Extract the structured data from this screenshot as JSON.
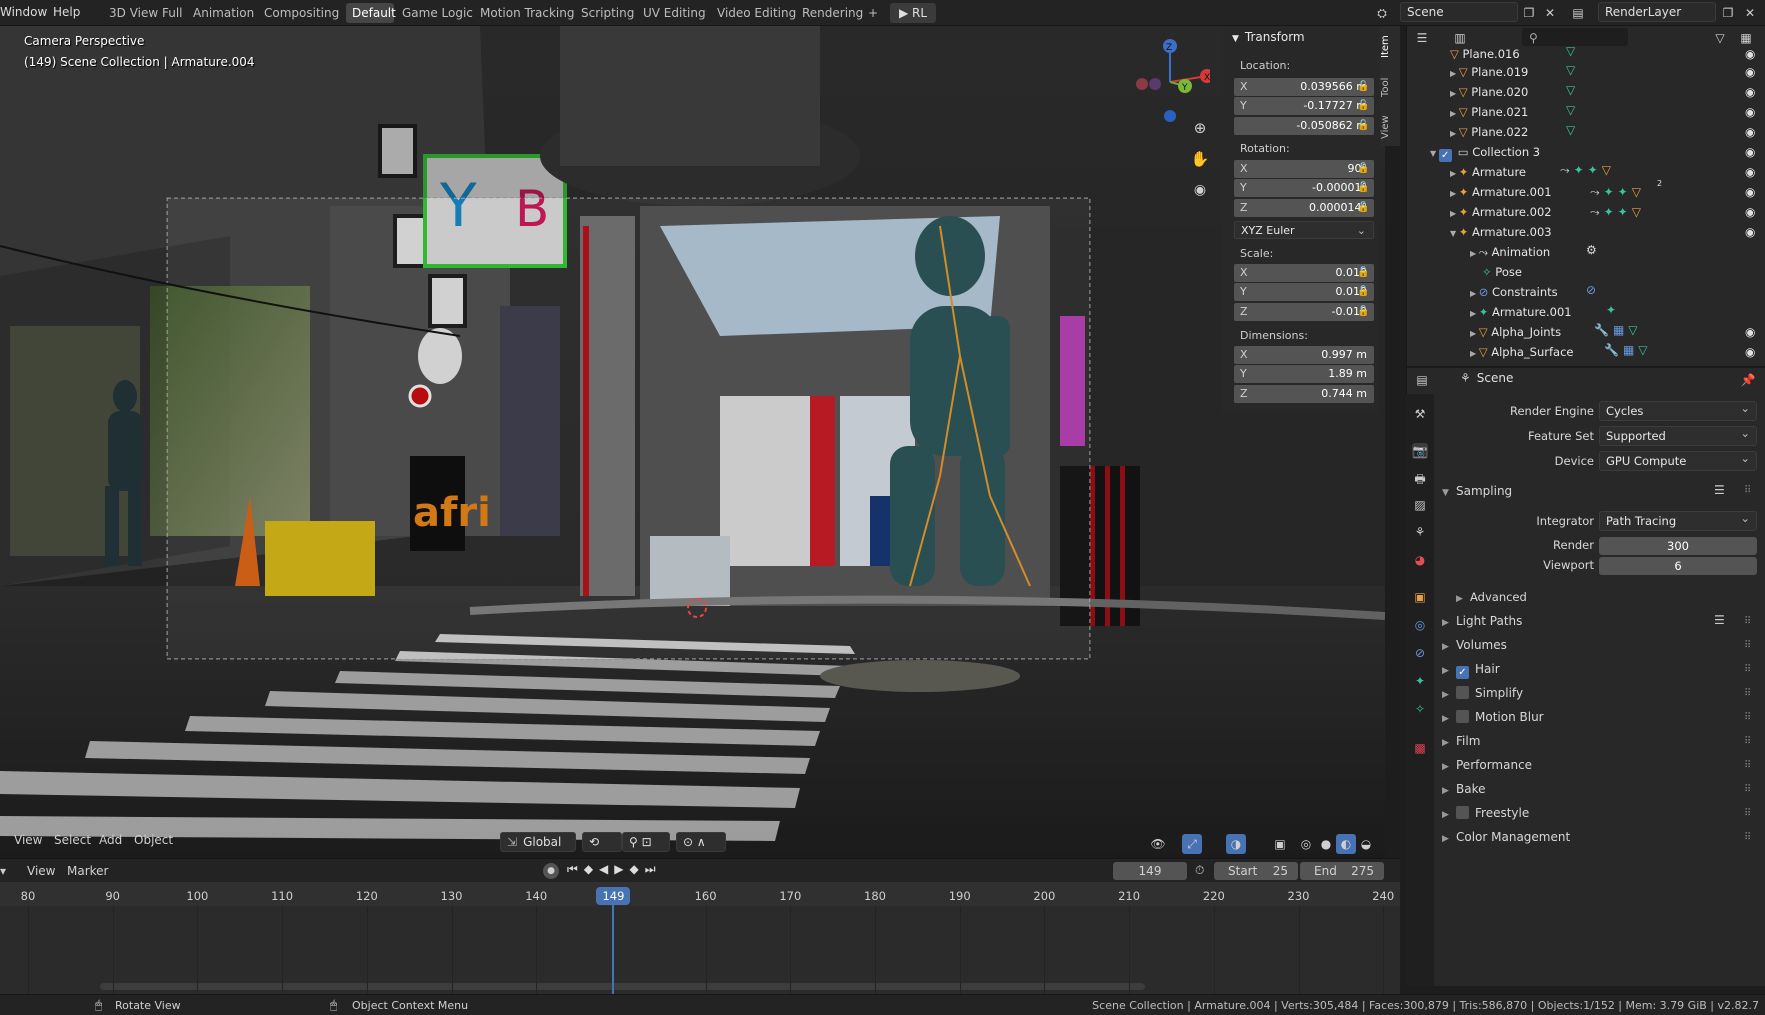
{
  "topbar": {
    "menus": [
      "Window",
      "Help"
    ],
    "workspaces": [
      "3D View Full",
      "Animation",
      "Compositing",
      "Default",
      "Game Logic",
      "Motion Tracking",
      "Scripting",
      "UV Editing",
      "Video Editing",
      "Rendering"
    ],
    "active_workspace": "Default",
    "add_label": "+",
    "rl_button": "▶ RL",
    "scene_field": "Scene",
    "renderlayer_field": "RenderLayer"
  },
  "viewport": {
    "overlay_line1": "Camera Perspective",
    "overlay_line2": "(149) Scene Collection | Armature.004",
    "gizmo_axes": [
      "X",
      "Y",
      "Z"
    ],
    "sign_text": "afri",
    "header_menus": [
      "View",
      "Select",
      "Add",
      "Object"
    ],
    "transform_orientation": "Global"
  },
  "npanel": {
    "tabs": [
      "Item",
      "Tool",
      "View"
    ],
    "header": "Transform",
    "location_label": "Location:",
    "location": [
      {
        "axis": "X",
        "value": "0.039566 m"
      },
      {
        "axis": "Y",
        "value": "-0.17727 m"
      },
      {
        "axis": "",
        "value": "-0.050862 m"
      }
    ],
    "rotation_label": "Rotation:",
    "rotation": [
      {
        "axis": "X",
        "value": "90°"
      },
      {
        "axis": "Y",
        "value": "-0.00001°"
      },
      {
        "axis": "Z",
        "value": "0.000014°"
      }
    ],
    "rotation_mode": "XYZ Euler",
    "scale_label": "Scale:",
    "scale": [
      {
        "axis": "X",
        "value": "0.010"
      },
      {
        "axis": "Y",
        "value": "0.010"
      },
      {
        "axis": "Z",
        "value": "-0.010"
      }
    ],
    "dimensions_label": "Dimensions:",
    "dimensions": [
      {
        "axis": "X",
        "value": "0.997 m"
      },
      {
        "axis": "Y",
        "value": "1.89 m"
      },
      {
        "axis": "Z",
        "value": "0.744 m"
      }
    ]
  },
  "outliner": {
    "rows": [
      {
        "label": "Plane.016",
        "indent": 2
      },
      {
        "label": "Plane.019",
        "indent": 2
      },
      {
        "label": "Plane.020",
        "indent": 2
      },
      {
        "label": "Plane.021",
        "indent": 2
      },
      {
        "label": "Plane.022",
        "indent": 2
      },
      {
        "label": "Collection 3",
        "indent": 1
      },
      {
        "label": "Armature",
        "indent": 2
      },
      {
        "label": "Armature.001",
        "indent": 2
      },
      {
        "label": "Armature.002",
        "indent": 2
      },
      {
        "label": "Armature.003",
        "indent": 2
      },
      {
        "label": "Animation",
        "indent": 3
      },
      {
        "label": "Pose",
        "indent": 3
      },
      {
        "label": "Constraints",
        "indent": 3
      },
      {
        "label": "Armature.001",
        "indent": 3
      },
      {
        "label": "Alpha_Joints",
        "indent": 3
      },
      {
        "label": "Alpha_Surface",
        "indent": 3
      }
    ],
    "badge": "2"
  },
  "properties": {
    "context": "Scene",
    "render_engine_label": "Render Engine",
    "render_engine": "Cycles",
    "feature_set_label": "Feature Set",
    "feature_set": "Supported",
    "device_label": "Device",
    "device": "GPU Compute",
    "sampling_label": "Sampling",
    "integrator_label": "Integrator",
    "integrator": "Path Tracing",
    "render_label": "Render",
    "render_samples": "300",
    "viewport_label": "Viewport",
    "viewport_samples": "6",
    "advanced_label": "Advanced",
    "sections": [
      {
        "label": "Light Paths",
        "checkbox": null
      },
      {
        "label": "Volumes",
        "checkbox": null
      },
      {
        "label": "Hair",
        "checkbox": true
      },
      {
        "label": "Simplify",
        "checkbox": false
      },
      {
        "label": "Motion Blur",
        "checkbox": false
      },
      {
        "label": "Film",
        "checkbox": null
      },
      {
        "label": "Performance",
        "checkbox": null
      },
      {
        "label": "Bake",
        "checkbox": null
      },
      {
        "label": "Freestyle",
        "checkbox": false
      },
      {
        "label": "Color Management",
        "checkbox": null
      }
    ]
  },
  "timeline": {
    "menus": [
      "View",
      "Marker"
    ],
    "current_frame": "149",
    "start_label": "Start",
    "start": "25",
    "end_label": "End",
    "end": "275",
    "ticks": [
      "80",
      "90",
      "100",
      "110",
      "120",
      "130",
      "140",
      "149",
      "160",
      "170",
      "180",
      "190",
      "200",
      "210",
      "220",
      "230",
      "240"
    ],
    "playhead_frame": 149
  },
  "statusbar": {
    "hint1": "Rotate View",
    "hint2": "Object Context Menu",
    "stats": "Scene Collection | Armature.004 | Verts:305,484 | Faces:300,879 | Tris:586,870 | Objects:1/152 | Mem: 3.79 GiB | v2.82.7"
  }
}
